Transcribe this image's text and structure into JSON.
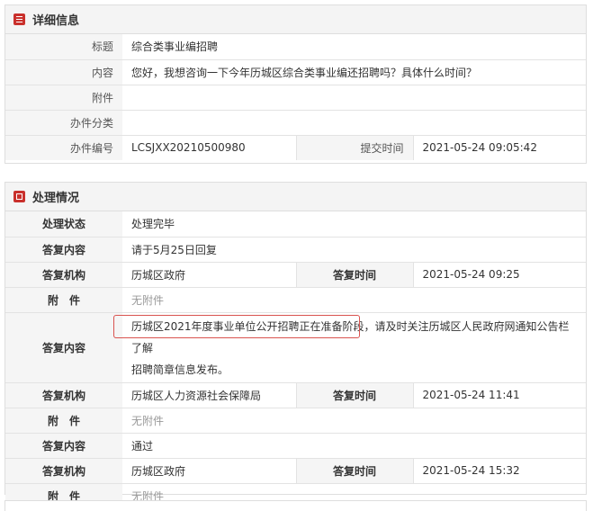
{
  "details": {
    "header": "详细信息",
    "rows": {
      "title_label": "标题",
      "title_value": "综合类事业编招聘",
      "content_label": "内容",
      "content_value": "您好，我想咨询一下今年历城区综合类事业编还招聘吗？具体什么时间？",
      "attach_label": "附件",
      "attach_value": "",
      "category_label": "办件分类",
      "category_value": "",
      "number_label": "办件编号",
      "number_value": "LCSJXX20210500980",
      "submit_label": "提交时间",
      "submit_value": "2021-05-24 09:05:42"
    }
  },
  "handling": {
    "header": "处理情况",
    "status_label": "处理状态",
    "status_value": "处理完毕",
    "reply1_label": "答复内容",
    "reply1_value": "请于5月25日回复",
    "org1_label": "答复机构",
    "org1_value": "历城区政府",
    "time1_label": "答复时间",
    "time1_value": "2021-05-24 09:25",
    "att1_label": "附　件",
    "att1_value": "无附件",
    "reply2_label": "答复内容",
    "reply2_highlight": "历城区2021年度事业单位公开招聘正在准备阶段",
    "reply2_rest": "，请及时关注历城区人民政府网通知公告栏了解",
    "reply2_line2": "招聘简章信息发布。",
    "org2_label": "答复机构",
    "org2_value": "历城区人力资源社会保障局",
    "time2_label": "答复时间",
    "time2_value": "2021-05-24 11:41",
    "att2_label": "附　件",
    "att2_value": "无附件",
    "reply3_label": "答复内容",
    "reply3_value": "通过",
    "org3_label": "答复机构",
    "org3_value": "历城区政府",
    "time3_label": "答复时间",
    "time3_value": "2021-05-24 15:32",
    "att3_label": "附　件",
    "att3_value": "无附件"
  }
}
